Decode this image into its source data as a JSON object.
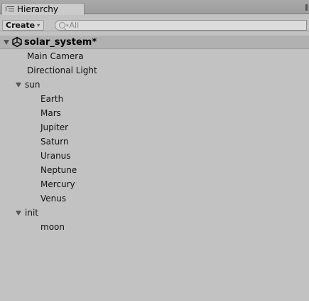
{
  "window": {
    "tab_title": "Hierarchy",
    "tab_icon": "hierarchy-list-icon"
  },
  "toolbar": {
    "create_label": "Create",
    "create_caret": "▾",
    "search_placeholder": "All",
    "search_icon": "search-icon"
  },
  "scene": {
    "name": "solar_system*",
    "icon": "unity-scene-icon",
    "expanded": true
  },
  "tree": [
    {
      "label": "Main Camera",
      "depth": 1,
      "expandable": false
    },
    {
      "label": "Directional Light",
      "depth": 1,
      "expandable": false
    },
    {
      "label": "sun",
      "depth": 1,
      "expandable": true,
      "expanded": true
    },
    {
      "label": "Earth",
      "depth": 2,
      "expandable": false
    },
    {
      "label": "Mars",
      "depth": 2,
      "expandable": false
    },
    {
      "label": "Jupiter",
      "depth": 2,
      "expandable": false
    },
    {
      "label": "Saturn",
      "depth": 2,
      "expandable": false
    },
    {
      "label": "Uranus",
      "depth": 2,
      "expandable": false
    },
    {
      "label": "Neptune",
      "depth": 2,
      "expandable": false
    },
    {
      "label": "Mercury",
      "depth": 2,
      "expandable": false
    },
    {
      "label": "Venus",
      "depth": 2,
      "expandable": false
    },
    {
      "label": "init",
      "depth": 1,
      "expandable": true,
      "expanded": true
    },
    {
      "label": "moon",
      "depth": 2,
      "expandable": false
    }
  ]
}
